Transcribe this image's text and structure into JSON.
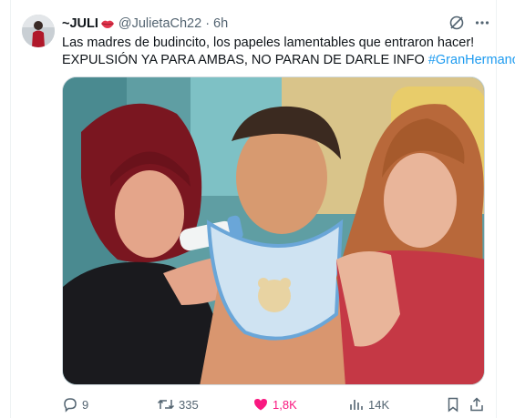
{
  "tweet": {
    "display_name": "~JULI",
    "name_emoji": "lips-emoji",
    "handle": "@JulietaCh22",
    "separator": "·",
    "time": "6h",
    "text_line1": "Las madres de budincito, los papeles lamentables que entraron hacer!",
    "text_line2": "EXPULSIÓN YA PARA AMBAS, NO PARAN DE DARLE INFO ",
    "hashtag": "#GranHermano",
    "media_icon": "photo",
    "header_icons": [
      "grok-icon",
      "more-icon"
    ]
  },
  "actions": {
    "replies": "9",
    "retweets": "335",
    "likes": "1,8K",
    "views": "14K",
    "icons": [
      "reply-icon",
      "retweet-icon",
      "heart-icon",
      "views-icon",
      "bookmark-icon",
      "share-icon"
    ]
  },
  "colors": {
    "accent": "#1d9bf0",
    "like": "#f91880",
    "muted": "#536471",
    "text": "#0f1419"
  }
}
